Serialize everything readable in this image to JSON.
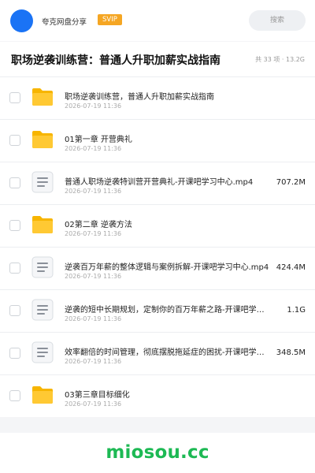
{
  "header": {
    "brand": "夸克网盘分享",
    "badge": "SVIP",
    "search_label": "搜索"
  },
  "folder": {
    "title": "职场逆袭训练营：普通人升职加薪实战指南",
    "info": "共 33 项 · 13.2G"
  },
  "files": [
    {
      "type": "folder",
      "icon": "folder-icon",
      "name": "职场逆袭训练营，普通人升职加薪实战指南",
      "date": "2026-07-19 11:36",
      "size": ""
    },
    {
      "type": "folder",
      "icon": "folder-icon",
      "name": "01第一章 开营典礼",
      "date": "2026-07-19 11:36",
      "size": ""
    },
    {
      "type": "file",
      "icon": "document-icon",
      "name": "普通人职场逆袭特训营开营典礼-开课吧学习中心.mp4",
      "date": "2026-07-19 11:36",
      "size": "707.2M"
    },
    {
      "type": "folder",
      "icon": "folder-icon",
      "name": "02第二章 逆袭方法",
      "date": "2026-07-19 11:36",
      "size": ""
    },
    {
      "type": "file",
      "icon": "document-icon",
      "name": "逆袭百万年薪的整体逻辑与案例拆解-开课吧学习中心.mp4",
      "date": "2026-07-19 11:36",
      "size": "424.4M"
    },
    {
      "type": "file",
      "icon": "document-icon",
      "name": "逆袭的短中长期规划，定制你的百万年薪之路-开课吧学习中心.mp4",
      "date": "2026-07-19 11:36",
      "size": "1.1G"
    },
    {
      "type": "file",
      "icon": "document-icon",
      "name": "效率翻倍的时间管理，彻底摆脱拖延症的困扰-开课吧学习中心.mp4",
      "date": "2026-07-19 11:36",
      "size": "348.5M"
    },
    {
      "type": "folder",
      "icon": "folder-icon",
      "name": "03第三章目标细化",
      "date": "2026-07-19 11:36",
      "size": ""
    }
  ],
  "watermark": "miosou.cc",
  "colors": {
    "avatar": "#1a73f5",
    "badge": "#f5a623",
    "folder": "#ffc933",
    "watermark": "#1db954"
  }
}
